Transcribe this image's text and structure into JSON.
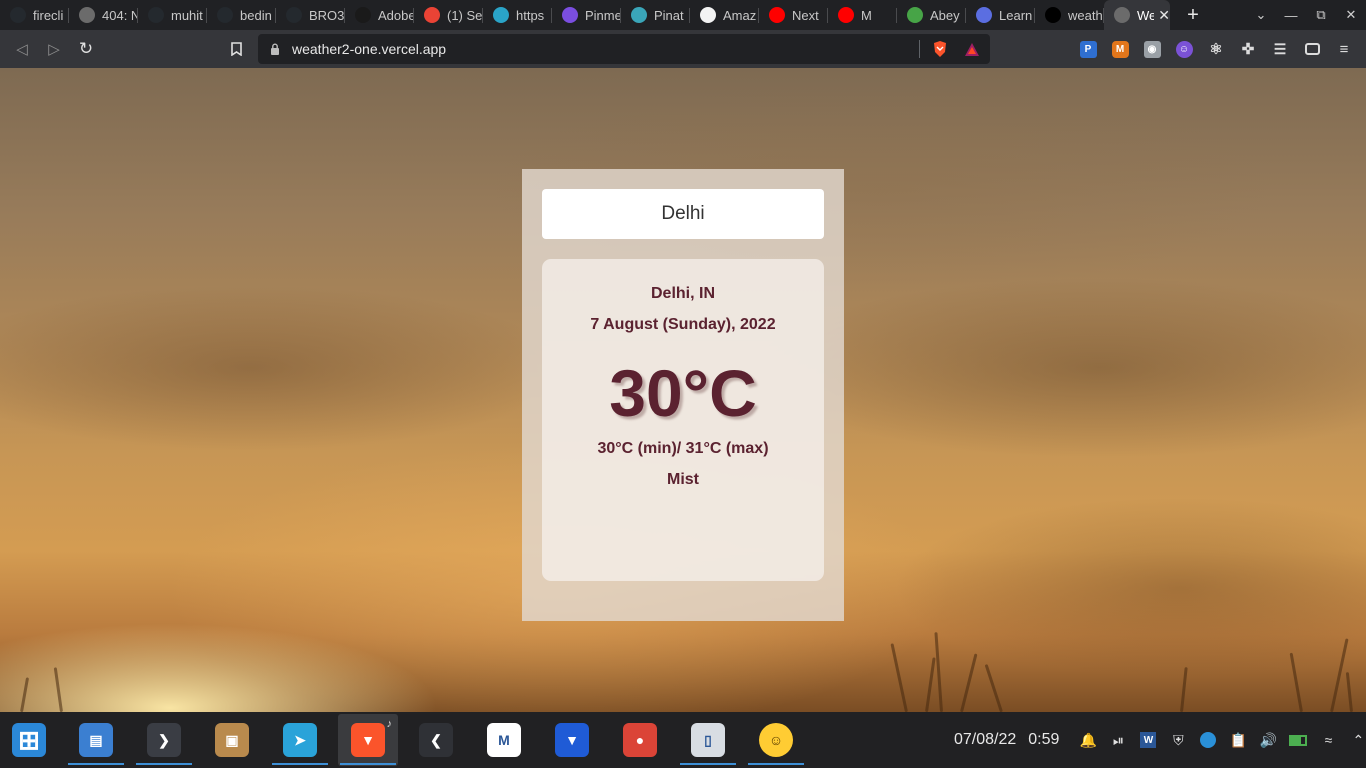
{
  "browser": {
    "tabs": [
      {
        "title": "firecli",
        "icon": "github-icon",
        "color": "#24292e"
      },
      {
        "title": "404: N",
        "icon": "globe-icon",
        "color": "#6b6b6b"
      },
      {
        "title": "muhit",
        "icon": "github-icon",
        "color": "#24292e"
      },
      {
        "title": "bedin",
        "icon": "github-icon",
        "color": "#24292e"
      },
      {
        "title": "BRO3",
        "icon": "github-icon",
        "color": "#24292e"
      },
      {
        "title": "Adobe",
        "icon": "adobe-icon",
        "color": "#1a1a1a"
      },
      {
        "title": "(1) Se",
        "icon": "google-icon",
        "color": "#ea4335"
      },
      {
        "title": "https",
        "icon": "cube-icon",
        "color": "#2aa4c8"
      },
      {
        "title": "Pinme",
        "icon": "pinme-icon",
        "color": "#7b4ee0"
      },
      {
        "title": "Pinat",
        "icon": "pinata-icon",
        "color": "#3aa6b9"
      },
      {
        "title": "Amaz",
        "icon": "amazon-icon",
        "color": "#f3f3f3"
      },
      {
        "title": "Next",
        "icon": "youtube-icon",
        "color": "#ff0000"
      },
      {
        "title": "M",
        "icon": "youtube-icon",
        "color": "#ff0000"
      },
      {
        "title": "Abey",
        "icon": "leaf-icon",
        "color": "#47a447"
      },
      {
        "title": "Learn",
        "icon": "diamond-icon",
        "color": "#5b6ee1"
      },
      {
        "title": "weath",
        "icon": "vercel-icon",
        "color": "#000000"
      },
      {
        "title": "We",
        "icon": "globe-icon",
        "color": "#6b6b6b"
      }
    ],
    "url": "weather2-one.vercel.app"
  },
  "weather": {
    "search_value": "Delhi",
    "location": "Delhi, IN",
    "date": "7 August (Sunday), 2022",
    "temperature": "30°C",
    "min_max": "30°C (min)/ 31°C (max)",
    "condition": "Mist"
  },
  "taskbar": {
    "date": "07/08/22",
    "time": "0:59",
    "apps": [
      {
        "name": "start-menu",
        "color": "#2b88d8",
        "running": false
      },
      {
        "name": "file-manager",
        "color": "#3b7fd1",
        "running": true
      },
      {
        "name": "terminal",
        "color": "#3a3d44",
        "running": true
      },
      {
        "name": "package-box",
        "color": "#b98a4d",
        "running": false
      },
      {
        "name": "telegram",
        "color": "#2aa3d9",
        "running": true
      },
      {
        "name": "brave-browser",
        "color": "#fb542b",
        "running": true,
        "current": true
      },
      {
        "name": "vscode",
        "color": "#2f3136",
        "running": false
      },
      {
        "name": "mongodb-compass",
        "color": "#ffffff",
        "running": false
      },
      {
        "name": "brave-beta",
        "color": "#1f5bd6",
        "running": false
      },
      {
        "name": "chrome-beta",
        "color": "#db4437",
        "running": false
      },
      {
        "name": "kde-connect",
        "color": "#d8dde3",
        "running": true
      },
      {
        "name": "emoji-picker",
        "color": "#ffcc33",
        "running": true
      }
    ]
  }
}
